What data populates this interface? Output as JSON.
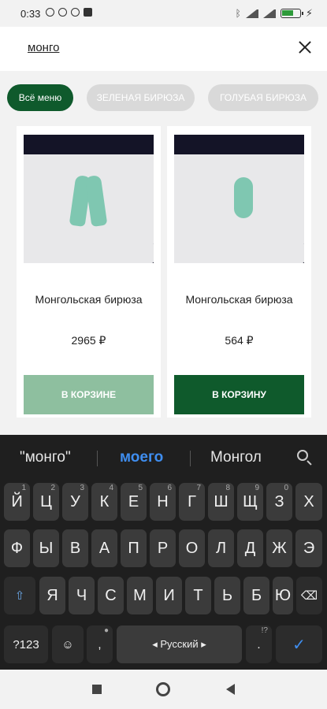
{
  "status_bar": {
    "time": "0:33"
  },
  "search": {
    "query": "монго"
  },
  "chips": [
    "Всё меню",
    "ЗЕЛЕНАЯ БИРЮЗА",
    "ГОЛУБАЯ БИРЮЗА"
  ],
  "products": [
    {
      "name": "Монгольская бирюза",
      "price": "2965 ₽",
      "button": "В КОРЗИНЕ"
    },
    {
      "name": "Монгольская бирюза",
      "price": "564 ₽",
      "button": "В КОРЗИНУ"
    }
  ],
  "keyboard": {
    "suggestions": [
      "\"монго\"",
      "моего",
      "Монгол"
    ],
    "row1": [
      "Й",
      "Ц",
      "У",
      "К",
      "Е",
      "Н",
      "Г",
      "Ш",
      "Щ",
      "З",
      "Х"
    ],
    "row1_sup": [
      "1",
      "2",
      "3",
      "4",
      "5",
      "6",
      "7",
      "8",
      "9",
      "0",
      ""
    ],
    "row2": [
      "Ф",
      "Ы",
      "В",
      "А",
      "П",
      "Р",
      "О",
      "Л",
      "Д",
      "Ж",
      "Э"
    ],
    "row3": [
      "Я",
      "Ч",
      "С",
      "М",
      "И",
      "Т",
      "Ь",
      "Б",
      "Ю"
    ],
    "symbols_label": "?123",
    "comma": ",",
    "space_label": "◂ Русский ▸",
    "period": ".",
    "period_sup": "!?"
  }
}
